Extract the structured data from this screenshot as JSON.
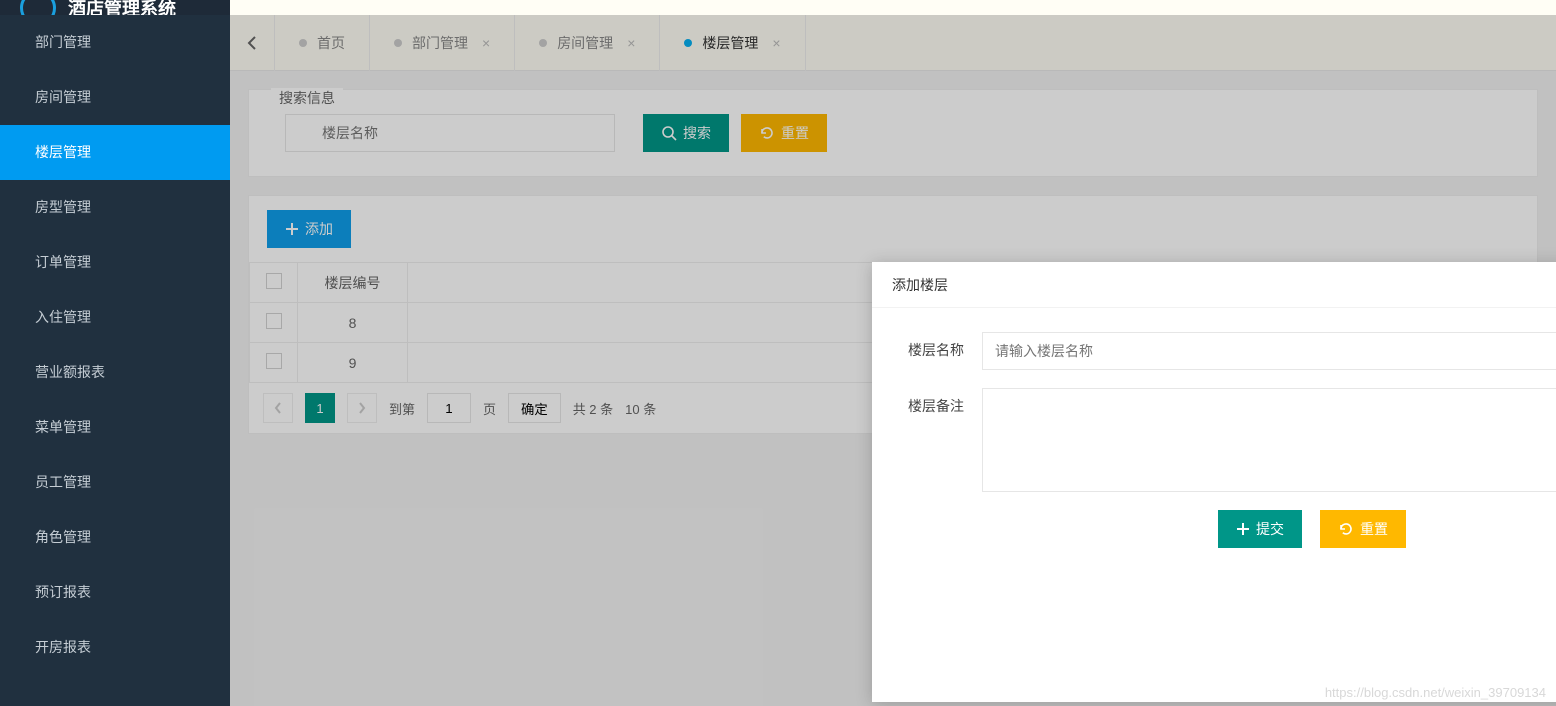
{
  "header": {
    "title": "酒店管理系统"
  },
  "sidebar": {
    "items": [
      {
        "label": "部门管理"
      },
      {
        "label": "房间管理"
      },
      {
        "label": "楼层管理"
      },
      {
        "label": "房型管理"
      },
      {
        "label": "订单管理"
      },
      {
        "label": "入住管理"
      },
      {
        "label": "营业额报表"
      },
      {
        "label": "菜单管理"
      },
      {
        "label": "员工管理"
      },
      {
        "label": "角色管理"
      },
      {
        "label": "预订报表"
      },
      {
        "label": "开房报表"
      }
    ],
    "active_index": 2
  },
  "tabs": {
    "items": [
      {
        "label": "首页",
        "closable": false
      },
      {
        "label": "部门管理",
        "closable": true
      },
      {
        "label": "房间管理",
        "closable": true
      },
      {
        "label": "楼层管理",
        "closable": true
      }
    ],
    "active_index": 3
  },
  "search": {
    "legend": "搜索信息",
    "placeholder": "楼层名称",
    "search_btn": "搜索",
    "reset_btn": "重置"
  },
  "toolbar": {
    "add_btn": "添加"
  },
  "table": {
    "header": "楼层编号",
    "rows": [
      {
        "num": "8"
      },
      {
        "num": "9"
      }
    ]
  },
  "pager": {
    "current": "1",
    "goto_label": "到第",
    "goto_value": "1",
    "page_unit": "页",
    "confirm": "确定",
    "total": "共 2 条",
    "pagesize": "10 条"
  },
  "modal": {
    "title": "添加楼层",
    "name_label": "楼层名称",
    "name_placeholder": "请输入楼层名称",
    "remark_label": "楼层备注",
    "submit": "提交",
    "reset": "重置"
  },
  "watermark": "https://blog.csdn.net/weixin_39709134"
}
